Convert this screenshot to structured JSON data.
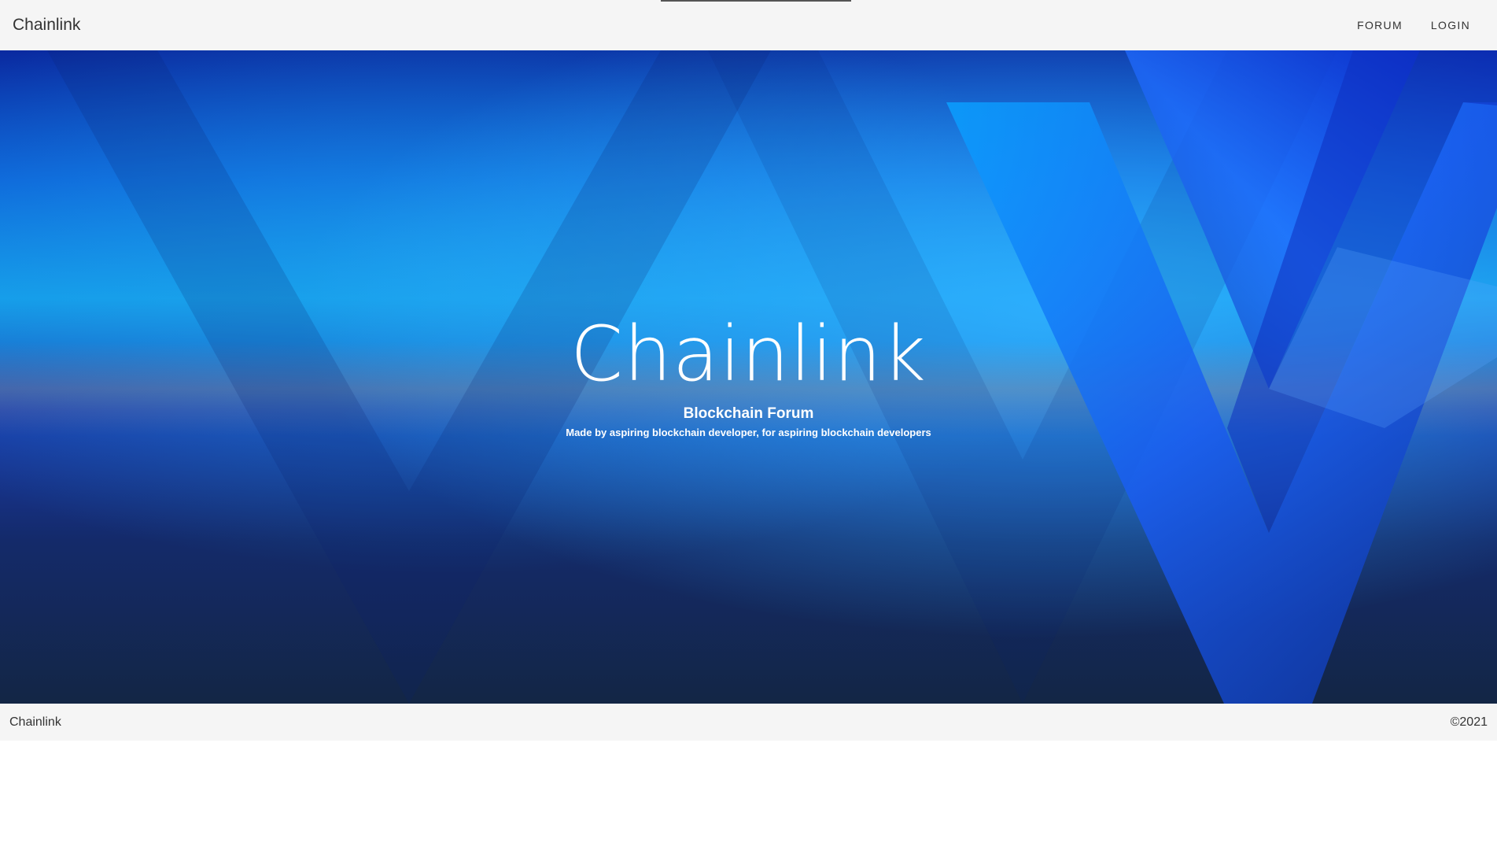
{
  "header": {
    "brand": "Chainlink",
    "nav": [
      {
        "label": "FORUM"
      },
      {
        "label": "LOGIN"
      }
    ]
  },
  "hero": {
    "title": "Chainlink",
    "subtitle": "Blockchain Forum",
    "tagline": "Made by aspiring blockchain developer, for aspiring blockchain developers",
    "background": "blue-v-logo-background"
  },
  "footer": {
    "brand": "Chainlink",
    "copyright": "©2021"
  },
  "colors": {
    "bar_background": "#f5f5f5",
    "text_dark": "#333333",
    "hero_text": "#ffffff",
    "hero_blue": "#0d62d8",
    "hero_navy": "#132645"
  }
}
